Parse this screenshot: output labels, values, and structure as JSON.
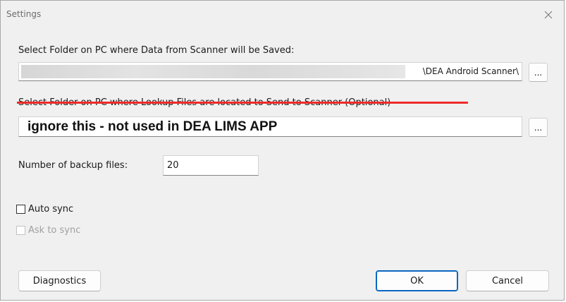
{
  "window": {
    "title": "Settings",
    "close_icon": "close-icon"
  },
  "data_folder": {
    "label": "Select Folder on PC where Data from Scanner will be Saved:",
    "value": "\\DEA Android Scanner\\",
    "browse_label": "..."
  },
  "lookup_folder": {
    "label": "Select Folder on PC where Lookup Files are located to Send to Scanner (Optional)",
    "value": "ignore this - not used in DEA LIMS APP",
    "browse_label": "...",
    "strike_color": "#ee2b2b"
  },
  "backup": {
    "label": "Number of backup files:",
    "value": "20"
  },
  "options": {
    "auto_sync": {
      "label": "Auto sync",
      "checked": false,
      "enabled": true
    },
    "ask_to_sync": {
      "label": "Ask to sync",
      "checked": false,
      "enabled": false
    }
  },
  "buttons": {
    "diagnostics": "Diagnostics",
    "ok": "OK",
    "cancel": "Cancel"
  },
  "colors": {
    "accent": "#0a66c2",
    "dialog_bg": "#f0f0f0"
  }
}
